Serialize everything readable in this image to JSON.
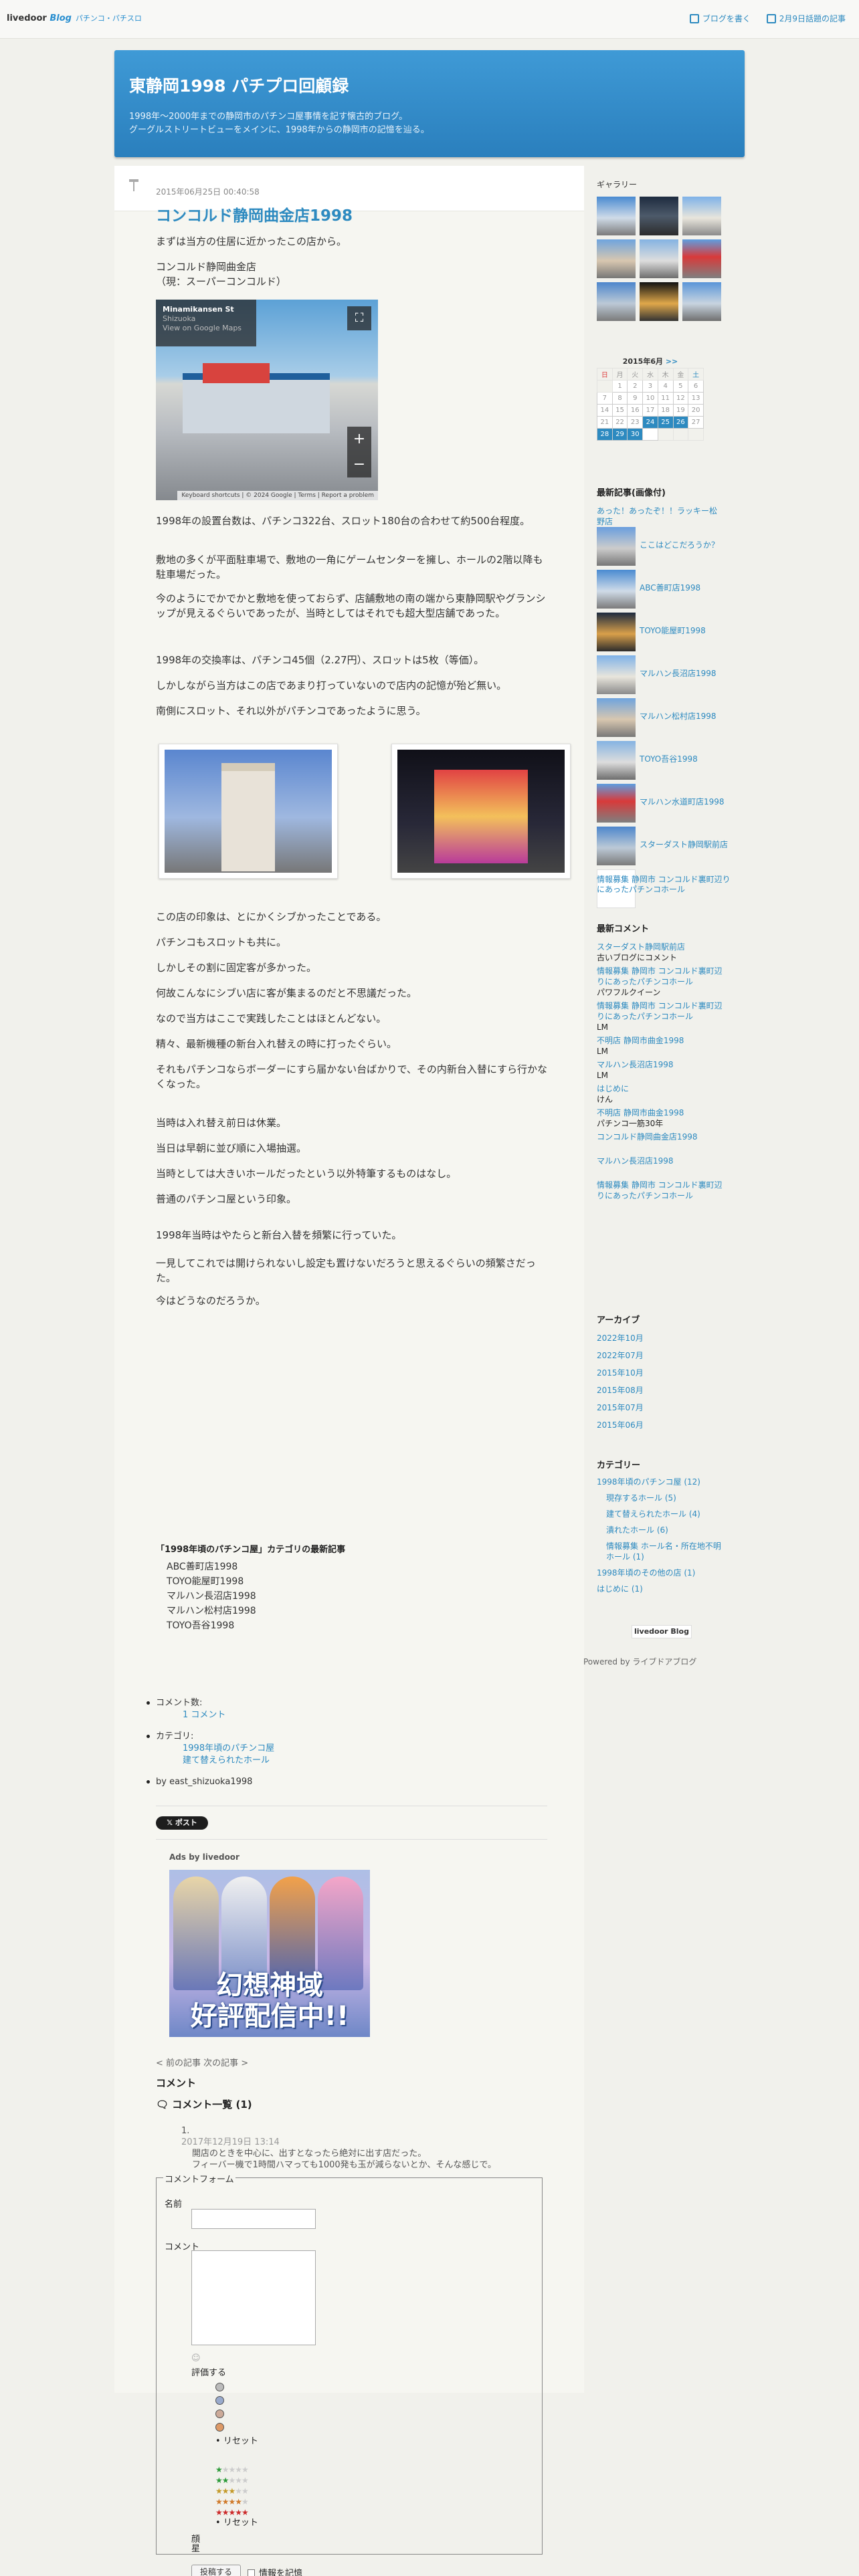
{
  "topbar": {
    "brand": "livedoor",
    "brand_blog": "Blog",
    "brand_sub": "パチンコ・パチスロ",
    "write_link": "ブログを書く",
    "archive_link": "2月9日話題の記事"
  },
  "header": {
    "title": "東静岡1998 パチプロ回顧録",
    "desc1": "1998年〜2000年までの静岡市のパチンコ屋事情を記す懐古的ブログ。",
    "desc2": "グーグルストリートビューをメインに、1998年からの静岡市の記憶を辿る。"
  },
  "post": {
    "date": "2015年06月25日 00:40:58",
    "title": "コンコルド静岡曲金店1998",
    "p1": "まずは当方の住居に近かったこの店から。",
    "p2a": "コンコルド静岡曲金店",
    "p2b": "（現：スーパーコンコルド）",
    "streetview": {
      "location": "Minamikansen St",
      "city": "Shizuoka",
      "link": "View on Google Maps",
      "footer": "Keyboard shortcuts | © 2024 Google | Terms | Report a problem",
      "google": "Google"
    },
    "p3": "1998年の設置台数は、パチンコ322台、スロット180台の合わせて約500台程度。",
    "p4": "敷地の多くが平面駐車場で、敷地の一角にゲームセンターを擁し、ホールの2階以降も駐車場だった。",
    "p5": "今のようにでかでかと敷地を使っておらず、店舗敷地の南の端から東静岡駅やグランシップが見えるぐらいであったが、当時としてはそれでも超大型店舗であった。",
    "p6": "1998年の交換率は、パチンコ45個（2.27円）、スロットは5枚（等価）。",
    "p7": "しかしながら当方はこの店であまり打っていないので店内の記憶が殆ど無い。",
    "p8": "南側にスロット、それ以外がパチンコであったように思う。",
    "p9": "この店の印象は、とにかくシブかったことである。",
    "p10": "パチンコもスロットも共に。",
    "p11": "しかしその割に固定客が多かった。",
    "p12": "何故こんなにシブい店に客が集まるのだと不思議だった。",
    "p13": "なので当方はここで実践したことはほとんどない。",
    "p14": "精々、最新機種の新台入れ替えの時に打ったぐらい。",
    "p15": "それもパチンコならボーダーにすら届かない台ばかりで、その内新台入替にすら行かなくなった。",
    "p16": "当時は入れ替え前日は休業。",
    "p17": "当日は早朝に並び順に入場抽選。",
    "p18": "当時としては大きいホールだったという以外特筆するものはなし。",
    "p19": "普通のパチンコ屋という印象。",
    "p20": "1998年当時はやたらと新台入替を頻繁に行っていた。",
    "p21": "一見してこれでは開けられないし設定も置けないだろうと思えるぐらいの頻繁さだった。",
    "p22": "今はどうなのだろうか。"
  },
  "related": {
    "heading": "「1998年頃のパチンコ屋」カテゴリの最新記事",
    "items": [
      "ABC善町店1998",
      "TOYO能屋町1998",
      "マルハン長沼店1998",
      "マルハン松村店1998",
      "TOYO吾谷1998"
    ]
  },
  "meta": {
    "comments_label": "コメント数:",
    "comments_value": "1 コメント",
    "category_label": "カテゴリ:",
    "cat1": "1998年頃のパチンコ屋",
    "cat2": "建て替えられたホール",
    "author": "by east_shizuoka1998"
  },
  "tweet": "ポスト",
  "ads": {
    "label": "Ads by livedoor",
    "banner_text": "幻想神域",
    "banner_text2": "好評配信中!!"
  },
  "prev_link": "< 前の記事 次の記事 >",
  "comments": {
    "heading": "コメント",
    "list_heading": "コメント一覧 (1)",
    "num": "1.",
    "date": "2017年12月19日 13:14",
    "text1": "開店のときを中心に、出すとなったら絶対に出す店だった。",
    "text2": "フィーバー機で1時間ハマっても1000発も玉が減らないとか、そんな感じで。"
  },
  "form": {
    "legend": "コメントフォーム",
    "name": "名前",
    "comment": "コメント",
    "rate": "評価する",
    "reset": "リセット",
    "reset2": "リセット",
    "pp_a": "顔",
    "pp_b": "星",
    "submit": "投稿する",
    "remember": "情報を記憶"
  },
  "sidebar": {
    "gallery": "ギャラリー",
    "cal_title": "2015年6月",
    "cal_next": ">>",
    "days": [
      "日",
      "月",
      "火",
      "水",
      "木",
      "金",
      "土"
    ],
    "cal": [
      [
        "",
        "1",
        "2",
        "3",
        "4",
        "5",
        "6"
      ],
      [
        "7",
        "8",
        "9",
        "10",
        "11",
        "12",
        "13"
      ],
      [
        "14",
        "15",
        "16",
        "17",
        "18",
        "19",
        "20"
      ],
      [
        "21",
        "22",
        "23",
        "24",
        "25",
        "26",
        "27"
      ],
      [
        "28",
        "29",
        "30",
        "",
        "",
        "",
        ""
      ]
    ],
    "recent_heading": "最新記事(画像付)",
    "recent_top": "あった！あったぞ！！ラッキー松野店",
    "recent": [
      "ここはどこだろうか？",
      "ABC善町店1998",
      "TOYO能屋町1998",
      "マルハン長沼店1998",
      "マルハン松村店1998",
      "TOYO吾谷1998",
      "マルハン水道町店1998",
      "スターダスト静岡駅前店",
      "情報募集 静岡市 コンコルド裏町辺りにあったパチンコホール"
    ],
    "comments_heading": "最新コメント",
    "comments": [
      {
        "t": "スターダスト静岡駅前店",
        "a": "古いブログにコメント"
      },
      {
        "t": "情報募集 静岡市 コンコルド裏町辺りにあったパチンコホール",
        "a": "パワフルクイーン"
      },
      {
        "t": "情報募集 静岡市 コンコルド裏町辺りにあったパチンコホール",
        "a": "LM"
      },
      {
        "t": "不明店 静岡市曲金1998",
        "a": "LM"
      },
      {
        "t": "マルハン長沼店1998",
        "a": "LM"
      },
      {
        "t": "はじめに",
        "a": "けん"
      },
      {
        "t": "不明店 静岡市曲金1998",
        "a": "パチンコ一筋30年"
      },
      {
        "t": "コンコルド静岡曲金店1998",
        "a": ""
      },
      {
        "t": "マルハン長沼店1998",
        "a": ""
      },
      {
        "t": "情報募集 静岡市 コンコルド裏町辺りにあったパチンコホール",
        "a": ""
      }
    ],
    "archive_heading": "アーカイブ",
    "archive": [
      "2022年10月",
      "2022年07月",
      "2015年10月",
      "2015年08月",
      "2015年07月",
      "2015年06月"
    ],
    "cat_heading": "カテゴリー",
    "cats": [
      "1998年頃のパチンコ屋 (12)",
      "現存するホール (5)",
      "建て替えられたホール (4)",
      "潰れたホール (6)",
      "情報募集 ホール名・所在地不明ホール (1)",
      "1998年頃のその他の店 (1)",
      "はじめに (1)"
    ],
    "footer_logo": "livedoor Blog",
    "powered": "Powered by ライブドアブログ"
  },
  "colors": {
    "accent": "#2d8ac0",
    "header_bg": "#3f9ad6"
  }
}
